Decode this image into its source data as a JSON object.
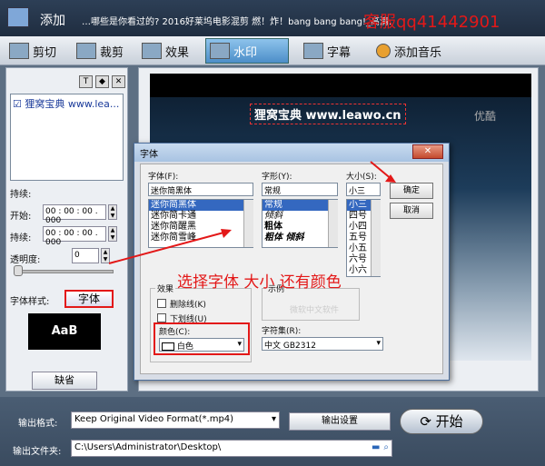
{
  "topbar": {
    "add_label": "添加",
    "marquee": "…哪些是你看过的? 2016好莱坞电影混剪 燃！炸！bang bang bang!_高清.",
    "service": "客服qq41442901"
  },
  "tabs": [
    {
      "label": "剪切"
    },
    {
      "label": "裁剪"
    },
    {
      "label": "效果"
    },
    {
      "label": "水印"
    },
    {
      "label": "字幕"
    },
    {
      "label": "添加音乐"
    }
  ],
  "left": {
    "watermark_item": "狸窝宝典 www.lea...",
    "duration_label": "持续:",
    "start_label": "开始:",
    "start_value": "00 : 00 : 00 . 000",
    "duration2_label": "持续:",
    "duration2_value": "00 : 00 : 00 . 000",
    "opacity_label": "透明度:",
    "opacity_value": "0",
    "font_style_label": "字体样式:",
    "font_button": "字体",
    "preview_text": "AaB",
    "default_button": "缺省"
  },
  "video": {
    "watermark_text": "狸窝宝典 www.leawo.cn",
    "corner_logo": "优酷"
  },
  "dialog": {
    "title": "字体",
    "font_label": "字体(F):",
    "font_value": "迷你简黑体",
    "font_list": [
      "迷你简黑体",
      "迷你简卡通",
      "迷你简醒黑",
      "迷你简雪峰"
    ],
    "style_label": "字形(Y):",
    "style_value": "常规",
    "style_list": [
      "常规",
      "倾斜",
      "粗体",
      "粗体 倾斜"
    ],
    "size_label": "大小(S):",
    "size_value": "小三",
    "size_list": [
      "小三",
      "四号",
      "小四",
      "五号",
      "小五",
      "六号",
      "小六"
    ],
    "ok_button": "确定",
    "cancel_button": "取消",
    "effects_label": "效果",
    "strike_label": "删除线(K)",
    "underline_label": "下划线(U)",
    "color_label": "颜色(C):",
    "color_value": "白色",
    "sample_label": "示例",
    "sample_text": "微软中文软件",
    "charset_label": "字符集(R):",
    "charset_value": "中文 GB2312"
  },
  "annotation": "选择字体 大小 还有颜色",
  "bottom": {
    "format_label": "输出格式:",
    "format_value": "Keep Original Video Format(*.mp4)",
    "settings_button": "输出设置",
    "start_button": "开始",
    "folder_label": "输出文件夹:",
    "folder_value": "C:\\Users\\Administrator\\Desktop\\"
  }
}
